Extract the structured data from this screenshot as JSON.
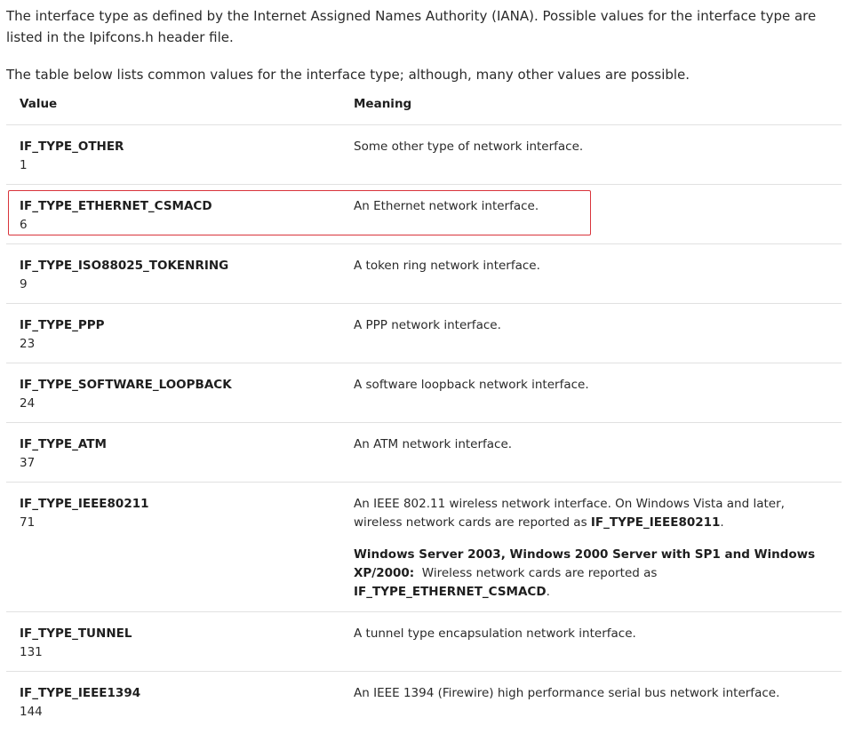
{
  "intro": {
    "paragraph1": "The interface type as defined by the Internet Assigned Names Authority (IANA). Possible values for the interface type are listed in the Ipifcons.h header file.",
    "paragraph2": "The table below lists common values for the interface type; although, many other values are possible."
  },
  "table": {
    "headers": {
      "value": "Value",
      "meaning": "Meaning"
    },
    "rows": [
      {
        "name": "IF_TYPE_OTHER",
        "number": "1",
        "meaning": "Some other type of network interface."
      },
      {
        "name": "IF_TYPE_ETHERNET_CSMACD",
        "number": "6",
        "meaning": "An Ethernet network interface."
      },
      {
        "name": "IF_TYPE_ISO88025_TOKENRING",
        "number": "9",
        "meaning": "A token ring network interface."
      },
      {
        "name": "IF_TYPE_PPP",
        "number": "23",
        "meaning": "A PPP network interface."
      },
      {
        "name": "IF_TYPE_SOFTWARE_LOOPBACK",
        "number": "24",
        "meaning": "A software loopback network interface."
      },
      {
        "name": "IF_TYPE_ATM",
        "number": "37",
        "meaning": "An ATM network interface."
      },
      {
        "name": "IF_TYPE_IEEE80211",
        "number": "71",
        "meaning_p1_text": "An IEEE 802.11 wireless network interface. On Windows Vista and later, wireless network cards are reported as ",
        "meaning_p1_bold": "IF_TYPE_IEEE80211",
        "meaning_p1_end": ".",
        "meaning_p2_bold": "Windows Server 2003, Windows 2000 Server with SP1 and Windows XP/2000:",
        "meaning_p2_text": "  Wireless network cards are reported as ",
        "meaning_p2_bold2": "IF_TYPE_ETHERNET_CSMACD",
        "meaning_p2_end": "."
      },
      {
        "name": "IF_TYPE_TUNNEL",
        "number": "131",
        "meaning": "A tunnel type encapsulation network interface."
      },
      {
        "name": "IF_TYPE_IEEE1394",
        "number": "144",
        "meaning": "An IEEE 1394 (Firewire) high performance serial bus network interface."
      }
    ]
  },
  "highlight": {
    "target": "IF_TYPE_ETHERNET_CSMACD",
    "color": "#d9343b"
  }
}
